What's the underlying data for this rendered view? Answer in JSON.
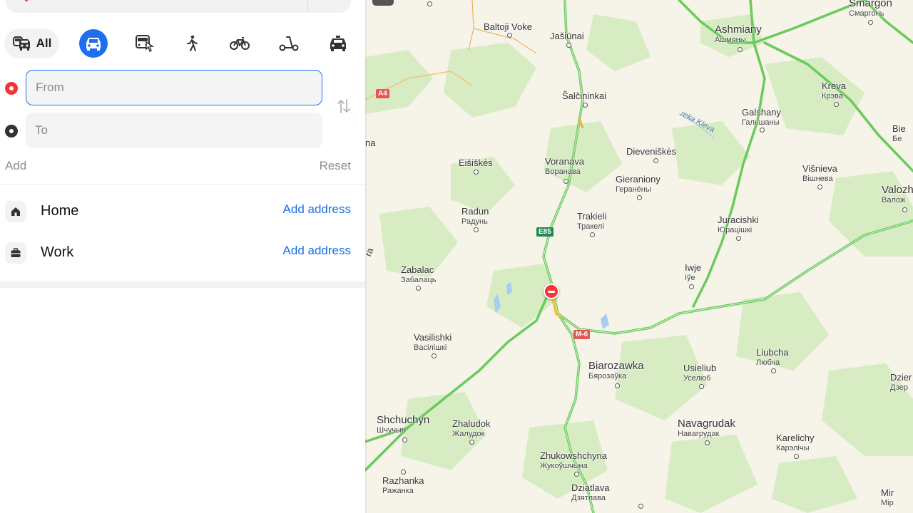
{
  "modes": {
    "all_label": "All",
    "items": [
      "all",
      "car",
      "bus",
      "walk",
      "bike",
      "scooter",
      "taxi"
    ],
    "active": "car"
  },
  "route": {
    "from_placeholder": "From",
    "to_placeholder": "To",
    "add_label": "Add",
    "reset_label": "Reset"
  },
  "favorites": {
    "home": {
      "name": "Home",
      "action": "Add address"
    },
    "work": {
      "name": "Work",
      "action": "Add address"
    }
  },
  "colors": {
    "accent": "#1e6ff0",
    "link": "#1a6ee8",
    "from_point": "#f43535",
    "road_green": "#6acb5d",
    "map_bg": "#f6f3e8",
    "forest": "#d8ecc4"
  },
  "map": {
    "towns": {
      "baltoji_voke": "Baltoji Voke",
      "jasiunai": "Jašiūnai",
      "salcininkai": "Šalčininkai",
      "eisiskes": "Eišiškės",
      "voranava": {
        "name": "Voranava",
        "cyr": "Воранава"
      },
      "dieveniskes": "Dieveniškės",
      "gieraniony": {
        "name": "Gieraniony",
        "cyr": "Геранёны"
      },
      "radun": {
        "name": "Radun",
        "cyr": "Радунь"
      },
      "trakieli": {
        "name": "Trakieli",
        "cyr": "Тракелі"
      },
      "zabalac": {
        "name": "Zabalac",
        "cyr": "Забалаць"
      },
      "vasilishki": {
        "name": "Vasilishki",
        "cyr": "Васілішкі"
      },
      "biarozawka": {
        "name": "Biarozawka",
        "cyr": "Бярозаўка"
      },
      "shchuchyn": {
        "name": "Shchuchyn",
        "cyr": "Шчучын"
      },
      "zhaludok": {
        "name": "Zhaludok",
        "cyr": "Жалудок"
      },
      "zhukowshchyna": {
        "name": "Zhukowshchyna",
        "cyr": "Жукоўшчына"
      },
      "dziatlava": {
        "name": "Dziatlava",
        "cyr": "Дзятлава"
      },
      "razhanka": {
        "name": "Razhanka",
        "cyr": "Ражанка"
      },
      "navagrudak": {
        "name": "Navagrudak",
        "cyr": "Навагрудак"
      },
      "usieliub": {
        "name": "Usieliub",
        "cyr": "Уселюб"
      },
      "liubcha": {
        "name": "Liubcha",
        "cyr": "Любча"
      },
      "karelichy": {
        "name": "Karelichy",
        "cyr": "Карэлічы"
      },
      "iwje": {
        "name": "Iwje",
        "cyr": "Іўе"
      },
      "juracishki": {
        "name": "Juracishki",
        "cyr": "Юрацішкі"
      },
      "galshany": {
        "name": "Galshany",
        "cyr": "Гальшаны"
      },
      "ashmiany": {
        "name": "Ashmiany",
        "cyr": "Ашмяны"
      },
      "smargon": {
        "name": "Smargon",
        "cyr": "Смаргонь"
      },
      "kreva": {
        "name": "Kreva",
        "cyr": "Крэва"
      },
      "vishnieva": {
        "name": "Višnieva",
        "cyr": "Вішнева"
      },
      "valozh": {
        "name": "Valozh",
        "cyr": "Валож"
      },
      "bie": {
        "name": "Bie",
        "cyr": "Бе"
      },
      "dzier": {
        "name": "Dzier",
        "cyr": "Дзер"
      },
      "mir": {
        "name": "Mir",
        "cyr": "Мір"
      }
    },
    "roads": {
      "a4": "A4",
      "e85": "E85",
      "m6": "M-6"
    },
    "river": "reka Kleva",
    "edge_fragments": {
      "na": "na",
      "ra": "ra"
    }
  }
}
